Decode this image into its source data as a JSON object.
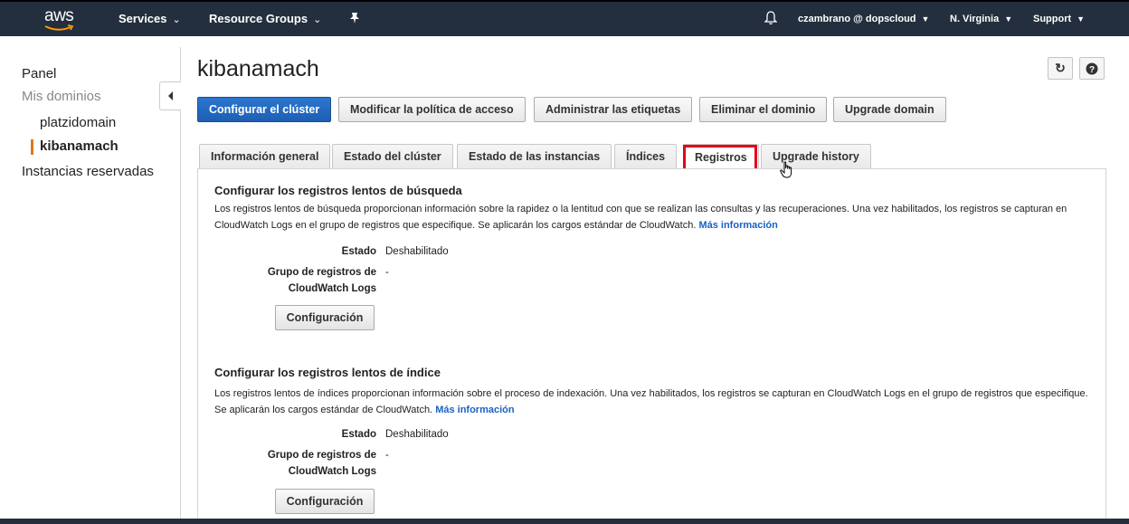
{
  "topbar": {
    "logo_text": "aws",
    "services_label": "Services",
    "resource_groups_label": "Resource Groups",
    "user_label": "czambrano @ dopscloud",
    "region_label": "N. Virginia",
    "support_label": "Support"
  },
  "sidebar": {
    "items": [
      {
        "label": "Panel"
      },
      {
        "label": "Mis dominios"
      },
      {
        "label": "platzidomain"
      },
      {
        "label": "kibanamach"
      },
      {
        "label": "Instancias reservadas"
      }
    ]
  },
  "main": {
    "title": "kibanamach",
    "refresh_icon": "↻",
    "help_icon": "?",
    "actions": {
      "configure": "Configurar el clúster",
      "modify_policy": "Modificar la política de acceso",
      "manage_tags": "Administrar las etiquetas",
      "delete_domain": "Eliminar el dominio",
      "upgrade_domain": "Upgrade domain"
    },
    "tabs": [
      {
        "label": "Información general"
      },
      {
        "label": "Estado del clúster"
      },
      {
        "label": "Estado de las instancias"
      },
      {
        "label": "Índices"
      },
      {
        "label": "Registros"
      },
      {
        "label": "Upgrade history"
      }
    ],
    "search_logs": {
      "title": "Configurar los registros lentos de búsqueda",
      "description": "Los registros lentos de búsqueda proporcionan información sobre la rapidez o la lentitud con que se realizan las consultas y las recuperaciones. Una vez habilitados, los registros se capturan en CloudWatch Logs en el grupo de registros que especifique. Se aplicarán los cargos estándar de CloudWatch.",
      "more_info": "Más información",
      "status_label": "Estado",
      "status_value": "Deshabilitado",
      "group_label_1": "Grupo de registros de",
      "group_label_2": "CloudWatch Logs",
      "group_value": "-",
      "config_button": "Configuración"
    },
    "index_logs": {
      "title": "Configurar los registros lentos de índice",
      "description": "Los registros lentos de índices proporcionan información sobre el proceso de indexación. Una vez habilitados, los registros se capturan en CloudWatch Logs en el grupo de registros que especifique. Se aplicarán los cargos estándar de CloudWatch.",
      "more_info": "Más información",
      "status_label": "Estado",
      "status_value": "Deshabilitado",
      "group_label_1": "Grupo de registros de",
      "group_label_2": "CloudWatch Logs",
      "group_value": "-",
      "config_button": "Configuración"
    }
  },
  "colors": {
    "topbar": "#232f3e",
    "primary": "#1e5fb3",
    "highlight": "#e3001b",
    "active_marker": "#e0781d",
    "link": "#1a61c4"
  },
  "icons": [
    "aws-logo-icon",
    "chevron-down-icon",
    "pin-icon",
    "bell-icon",
    "refresh-icon",
    "help-icon",
    "collapse-arrow-icon",
    "hand-cursor-icon"
  ]
}
